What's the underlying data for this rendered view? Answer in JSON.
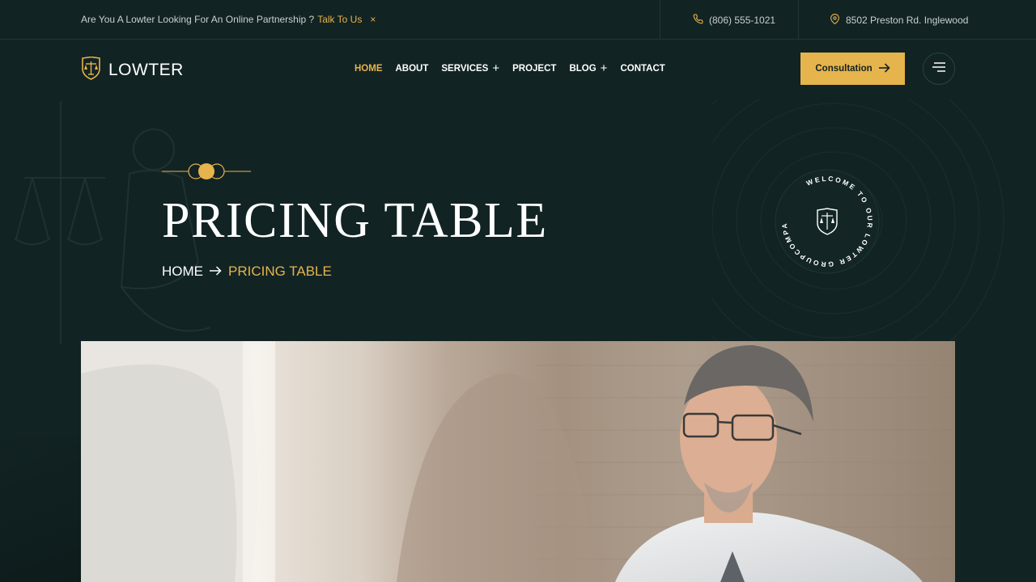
{
  "topbar": {
    "promo_text": "Are You A Lowter Looking For An Online Partnership ?",
    "promo_link": "Talk To Us",
    "close_icon": "×",
    "phone": "(806) 555-1021",
    "address": "8502 Preston Rd. Inglewood"
  },
  "header": {
    "brand": "LOWTER",
    "nav": [
      {
        "label": "HOME",
        "active": true,
        "has_submenu": false
      },
      {
        "label": "ABOUT",
        "active": false,
        "has_submenu": false
      },
      {
        "label": "SERVICES",
        "active": false,
        "has_submenu": true
      },
      {
        "label": "PROJECT",
        "active": false,
        "has_submenu": false
      },
      {
        "label": "BLOG",
        "active": false,
        "has_submenu": true
      },
      {
        "label": "CONTACT",
        "active": false,
        "has_submenu": false
      }
    ],
    "cta_label": "Consultation",
    "submenu_icon": "+"
  },
  "hero": {
    "title": "PRICING TABLE",
    "breadcrumb_home": "HOME",
    "breadcrumb_current": "PRICING TABLE",
    "badge_text": "WELCOME TO OUR LOWTER GROUPCOMPANY "
  },
  "colors": {
    "background": "#122323",
    "accent": "#e6b44c",
    "text": "#ffffff"
  },
  "icons": {
    "phone": "phone-icon",
    "location": "location-pin-icon",
    "logo": "shield-scales-icon",
    "cta_arrow": "arrow-right-icon",
    "menu": "hamburger-menu-icon"
  }
}
